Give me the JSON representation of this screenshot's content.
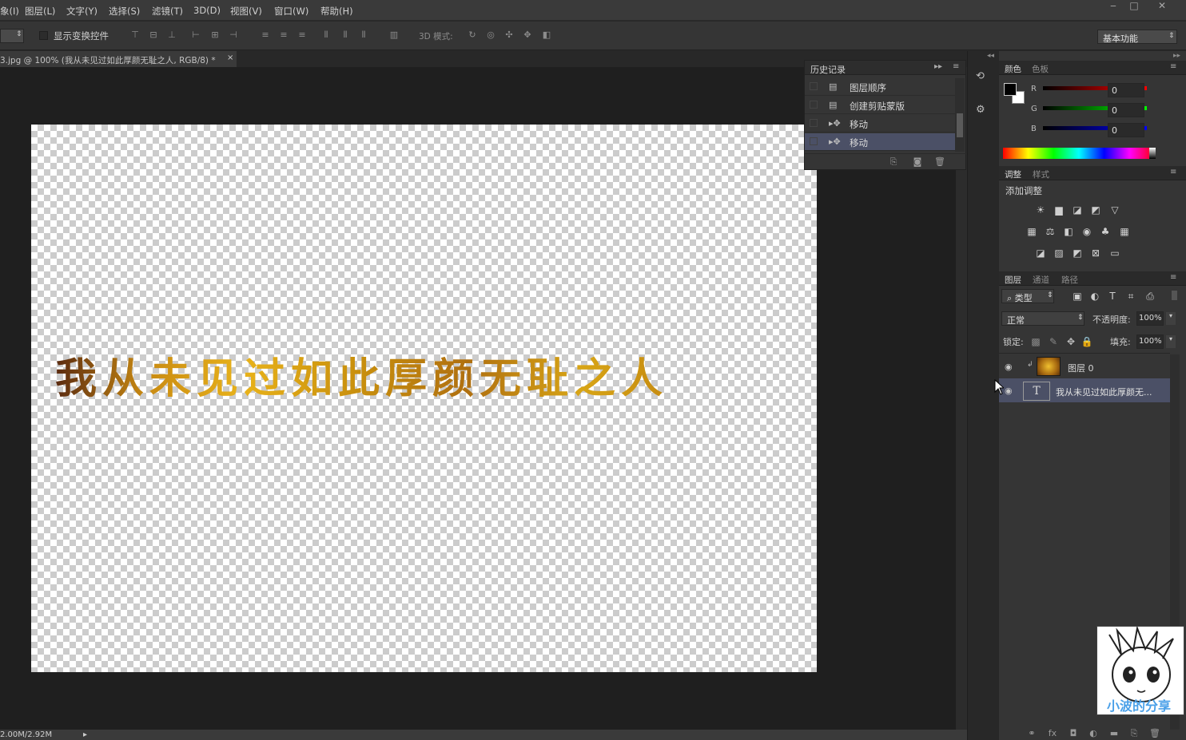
{
  "menubar": {
    "items": [
      "象(I)",
      "图层(L)",
      "文字(Y)",
      "选择(S)",
      "滤镜(T)",
      "3D(D)",
      "视图(V)",
      "窗口(W)",
      "帮助(H)"
    ],
    "win_min": "‒",
    "win_max": "□",
    "win_close": "✕"
  },
  "optionsbar": {
    "show_transform_label": "显示变换控件",
    "mode_3d_label": "3D 模式:",
    "workspace": "基本功能"
  },
  "document": {
    "tab_title": "3.jpg @ 100% (我从未见过如此厚颜无耻之人, RGB/8) *",
    "tab_close": "×",
    "canvas_text": "我从未见过如此厚颜无耻之人",
    "status": "2.00M/2.92M",
    "status_arrow": "▸"
  },
  "history": {
    "title": "历史记录",
    "items": [
      {
        "label": "图层顺序",
        "icon": "document-icon"
      },
      {
        "label": "创建剪贴蒙版",
        "icon": "document-icon"
      },
      {
        "label": "移动",
        "icon": "move-tool-icon"
      },
      {
        "label": "移动",
        "icon": "move-tool-icon"
      }
    ]
  },
  "color_panel": {
    "tabs": [
      "颜色",
      "色板"
    ],
    "channels": [
      {
        "name": "R",
        "value": "0",
        "color": "#d02020"
      },
      {
        "name": "G",
        "value": "0",
        "color": "#20a020"
      },
      {
        "name": "B",
        "value": "0",
        "color": "#2040d0"
      }
    ]
  },
  "adjust_panel": {
    "tabs": [
      "调整",
      "样式"
    ],
    "add_label": "添加调整"
  },
  "layers_panel": {
    "tabs": [
      "图层",
      "通道",
      "路径"
    ],
    "filter_kind": "类型",
    "blend_mode": "正常",
    "opacity_label": "不透明度:",
    "opacity_value": "100%",
    "lock_label": "锁定:",
    "fill_label": "填充:",
    "fill_value": "100%",
    "layers": [
      {
        "name": "图层 0",
        "type": "image"
      },
      {
        "name": "我从未见过如此厚颜无...",
        "type": "text",
        "thumb_glyph": "T"
      }
    ]
  },
  "watermark_text": "小波的分享"
}
